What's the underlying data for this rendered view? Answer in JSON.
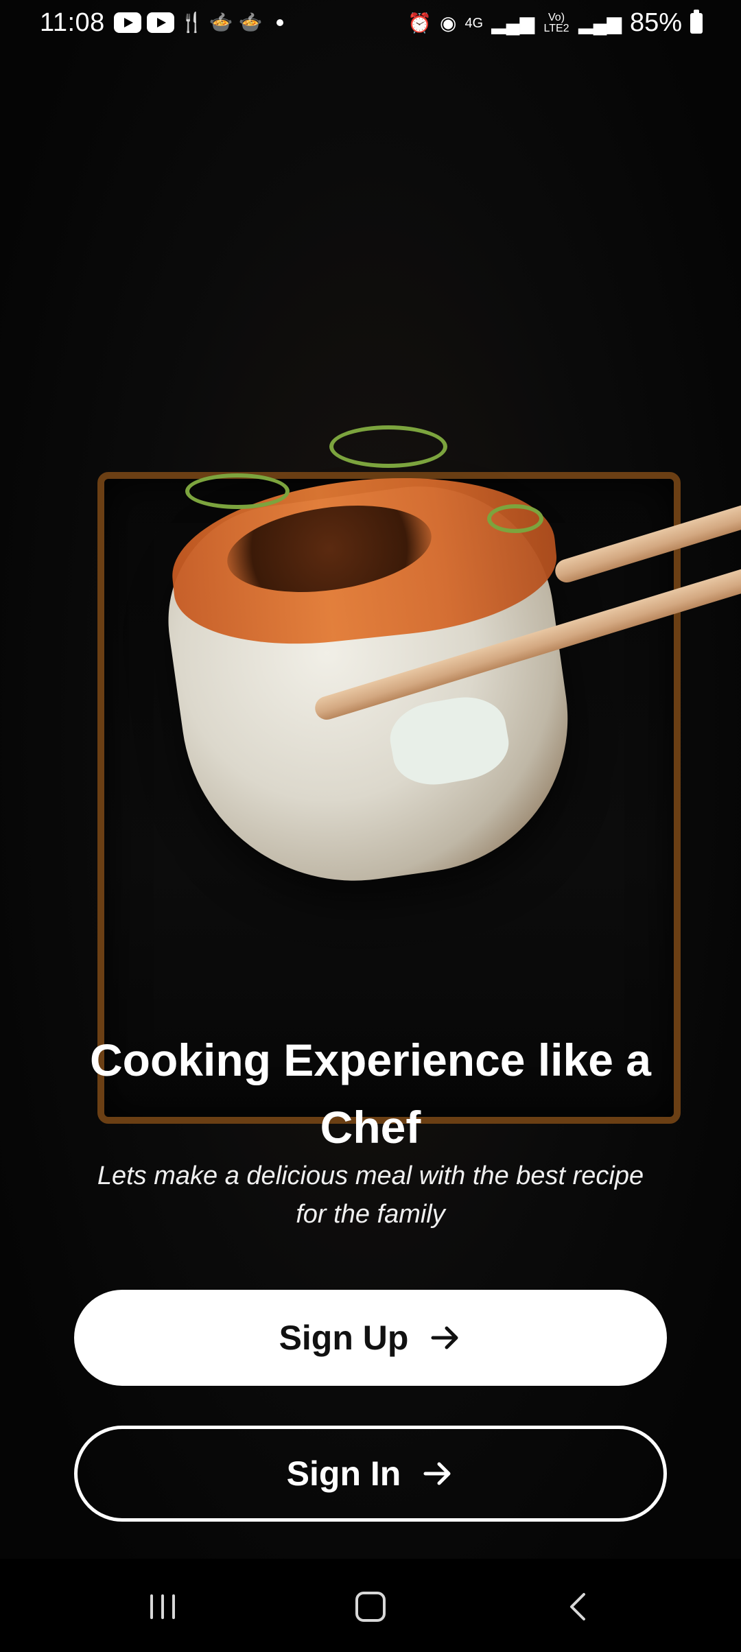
{
  "status_bar": {
    "time": "11:08",
    "left_icons": [
      "youtube-icon",
      "youtube-icon",
      "restaurant-icon",
      "bowl-icon",
      "bowl-icon",
      "dot-icon"
    ],
    "right_icons": [
      "alarm-icon",
      "hotspot-icon",
      "4g-icon",
      "signal-icon",
      "volte-icon",
      "signal-icon"
    ],
    "network_label_1": "4G",
    "network_label_2": "Vo) LTE2",
    "battery_percent": "85%"
  },
  "hero": {
    "image": "sushi-with-chopsticks",
    "accent_color": "#6b3f14"
  },
  "content": {
    "title": "Cooking Experience like a Chef",
    "subtitle": "Lets make a delicious meal with the best recipe for the family"
  },
  "buttons": {
    "signup_label": "Sign Up",
    "signin_label": "Sign In"
  },
  "navigation": {
    "recents": "recents-icon",
    "home": "home-icon",
    "back": "back-icon"
  }
}
